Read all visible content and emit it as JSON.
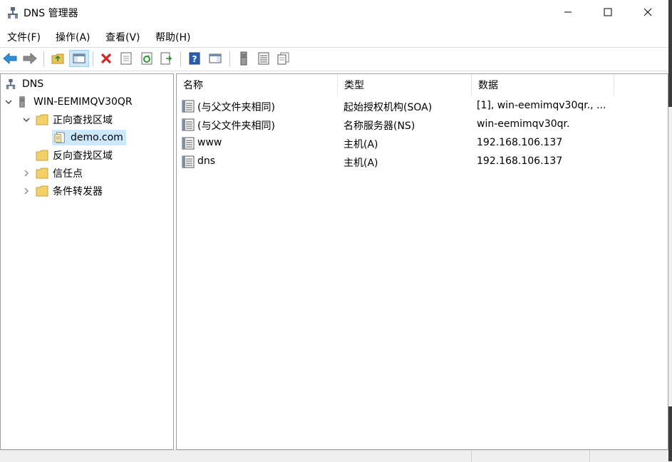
{
  "window": {
    "title": "DNS 管理器"
  },
  "menu": [
    "文件(F)",
    "操作(A)",
    "查看(V)",
    "帮助(H)"
  ],
  "toolbar": {
    "buttons": [
      "back",
      "forward",
      "up-folder",
      "show-hide-tree",
      "delete",
      "properties",
      "refresh",
      "export-list",
      "help",
      "show-hide-action-pane",
      "server",
      "record-list",
      "copy"
    ]
  },
  "tree": {
    "root": "DNS",
    "server": "WIN-EEMIMQV30QR",
    "forward_zone": "正向查找区域",
    "selected_zone": "demo.com",
    "reverse_zone": "反向查找区域",
    "trust_points": "信任点",
    "conditional_forwarders": "条件转发器"
  },
  "list": {
    "columns": [
      "名称",
      "类型",
      "数据"
    ],
    "rows": [
      {
        "name": "(与父文件夹相同)",
        "type": "起始授权机构(SOA)",
        "data": "[1], win-eemimqv30qr., ..."
      },
      {
        "name": "(与父文件夹相同)",
        "type": "名称服务器(NS)",
        "data": "win-eemimqv30qr."
      },
      {
        "name": "www",
        "type": "主机(A)",
        "data": "192.168.106.137"
      },
      {
        "name": "dns",
        "type": "主机(A)",
        "data": "192.168.106.137"
      }
    ]
  },
  "colors": {
    "selection": "#cce8ff",
    "border": "#a0a0a0",
    "statusbar": "#f0f0f0"
  }
}
